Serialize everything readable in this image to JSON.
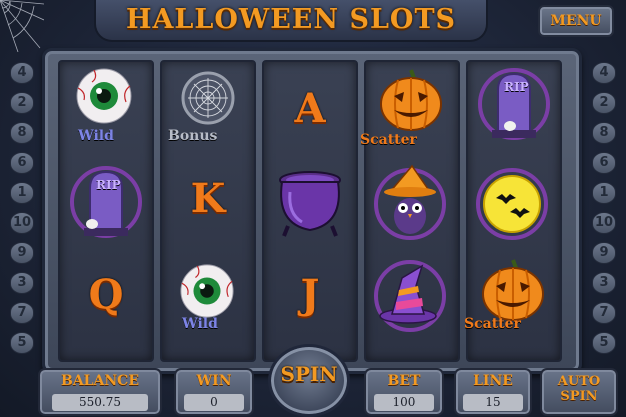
{
  "header": {
    "title": "Halloween Slots",
    "menu_label": "Menu"
  },
  "paylines": {
    "left": [
      "4",
      "2",
      "8",
      "6",
      "1",
      "10",
      "9",
      "3",
      "7",
      "5"
    ],
    "right": [
      "4",
      "2",
      "8",
      "6",
      "1",
      "10",
      "9",
      "3",
      "7",
      "5"
    ]
  },
  "reels": {
    "labels": {
      "wild": "Wild",
      "bonus": "Bonus",
      "scatter": "Scatter",
      "rip": "RIP"
    },
    "letters": {
      "a": "A",
      "k": "K",
      "q": "Q",
      "j": "J"
    }
  },
  "bottom_bar": {
    "balance_label": "Balance",
    "balance_value": "550.75",
    "win_label": "Win",
    "win_value": "0",
    "spin_label": "Spin",
    "bet_label": "Bet",
    "bet_value": "100",
    "line_label": "Line",
    "line_value": "15",
    "auto_spin_label_1": "Auto",
    "auto_spin_label_2": "Spin"
  },
  "colors": {
    "accent": "#f39a22",
    "wild": "#7d84e6",
    "panel": "#4b5568"
  }
}
